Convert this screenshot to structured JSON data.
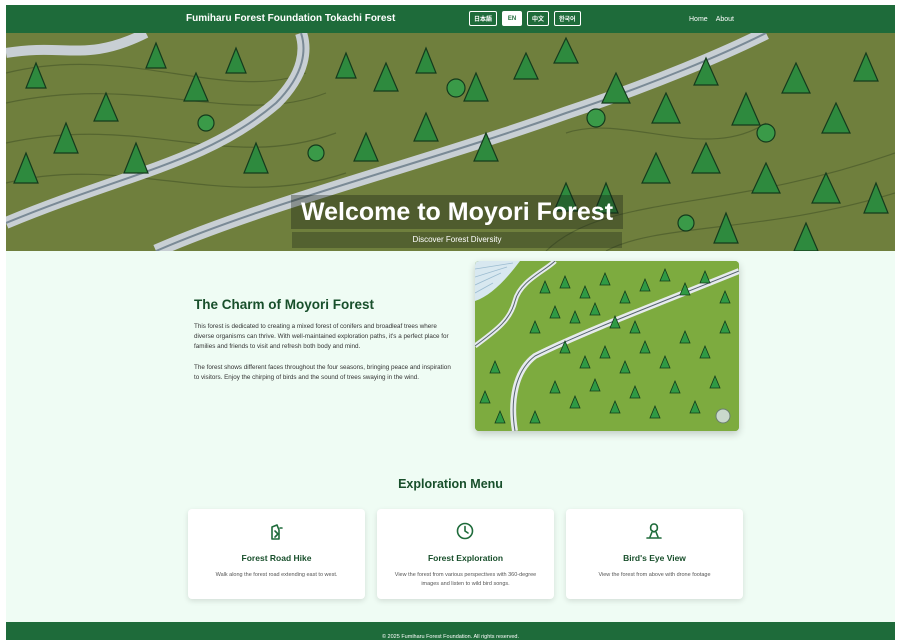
{
  "header": {
    "brand": "Fumiharu Forest Foundation Tokachi Forest",
    "languages": [
      {
        "label": "日本語",
        "active": false
      },
      {
        "label": "EN",
        "active": true
      },
      {
        "label": "中文",
        "active": false
      },
      {
        "label": "한국어",
        "active": false
      }
    ],
    "nav": [
      {
        "label": "Home"
      },
      {
        "label": "About"
      }
    ]
  },
  "hero": {
    "title": "Welcome to Moyori Forest",
    "subtitle": "Discover Forest Diversity"
  },
  "charm": {
    "title": "The Charm of Moyori Forest",
    "paragraphs": [
      "This forest is dedicated to creating a mixed forest of conifers and broadleaf trees where diverse organisms can thrive. With well-maintained exploration paths, it's a perfect place for families and friends to visit and refresh both body and mind.",
      "The forest shows different faces throughout the four seasons, bringing peace and inspiration to visitors. Enjoy the chirping of birds and the sound of trees swaying in the wind."
    ]
  },
  "exploration": {
    "title": "Exploration Menu",
    "cards": [
      {
        "title": "Forest Road Hike",
        "description": "Walk along the forest road extending east to west.",
        "icon": "hiker-icon"
      },
      {
        "title": "Forest Exploration",
        "description": "View the forest from various perspectives with 360-degree images and listen to wild bird songs.",
        "icon": "clock-icon"
      },
      {
        "title": "Bird's Eye View",
        "description": "View the forest from above with drone footage",
        "icon": "drone-icon"
      }
    ]
  },
  "footer": {
    "text": "© 2025 Fumiharu Forest Foundation. All rights reserved."
  },
  "colors": {
    "brand_green": "#1e6b3a",
    "dark_green": "#184f2b",
    "page_background": "#effcf4"
  }
}
